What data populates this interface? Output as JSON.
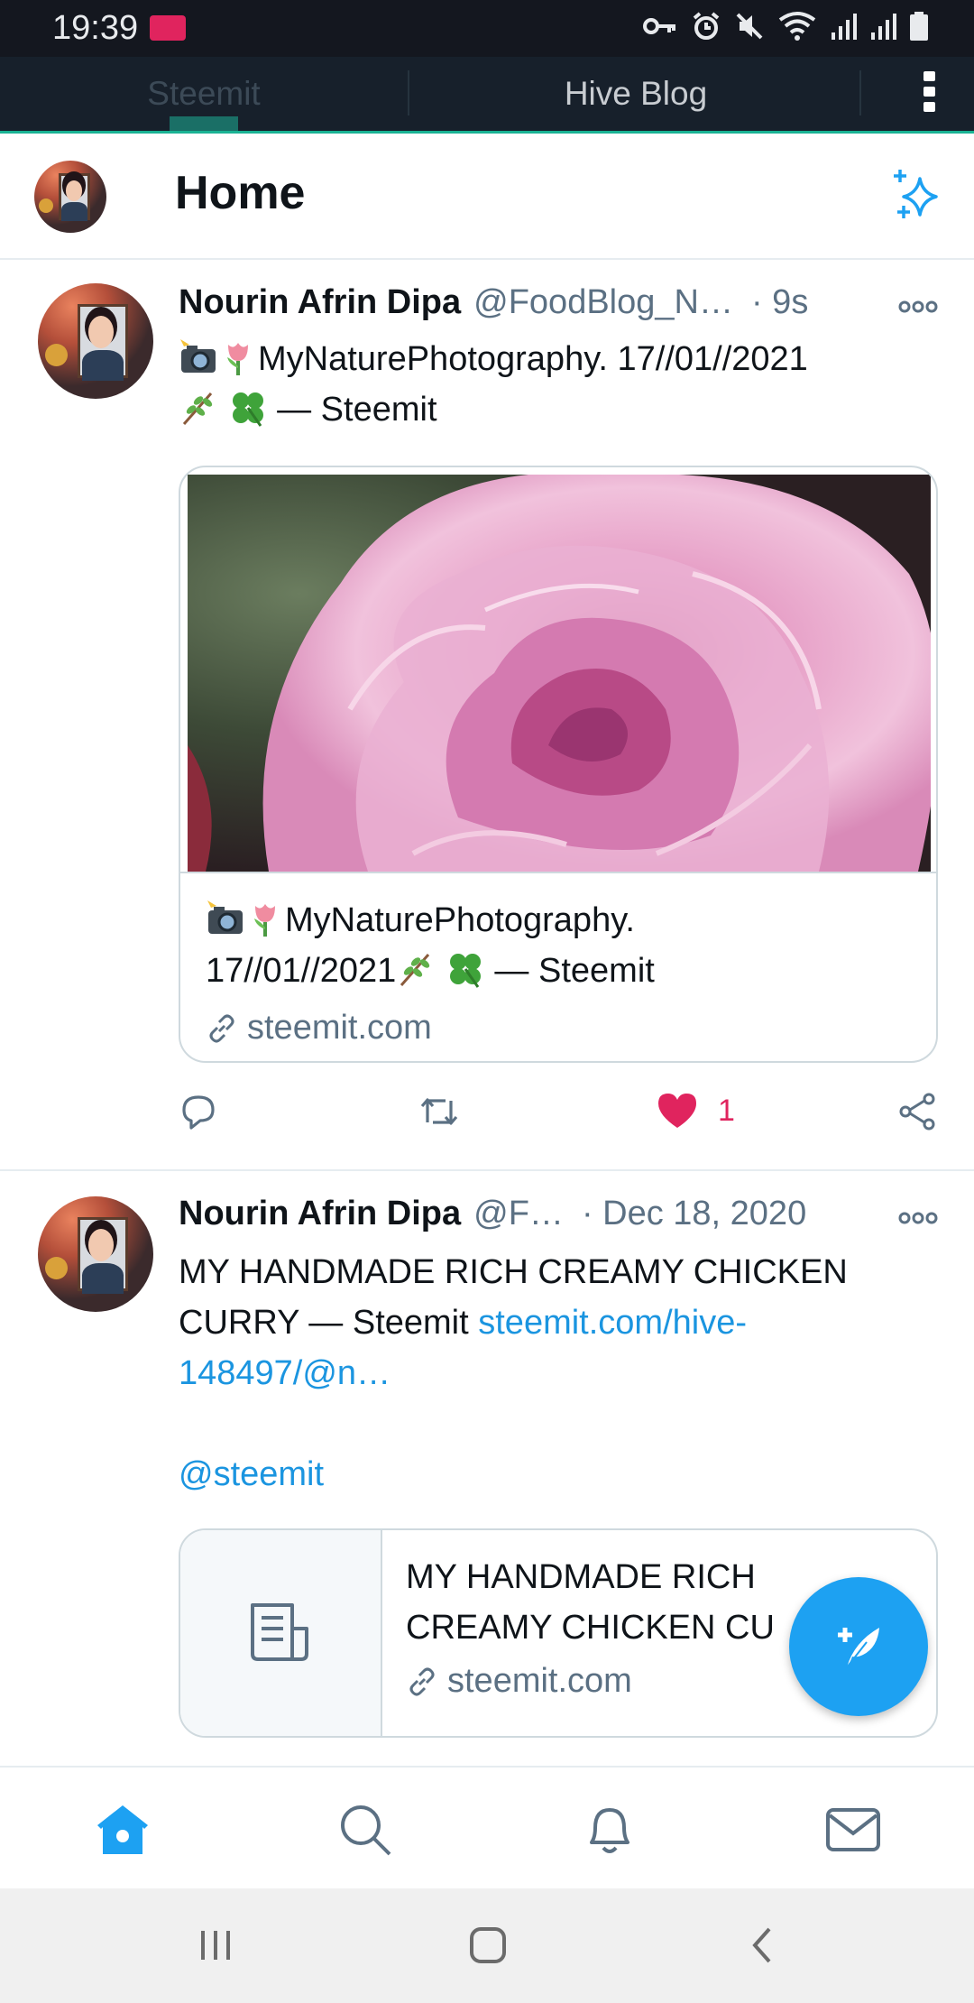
{
  "status_bar": {
    "time": "19:39",
    "icons": [
      "app-notification-icon",
      "key-icon",
      "alarm-icon",
      "mute-icon",
      "wifi-icon",
      "signal-icon",
      "signal-icon",
      "battery-icon"
    ]
  },
  "tabs": [
    {
      "label": "Steemit",
      "selected": true
    },
    {
      "label": "Hive Blog",
      "selected": false
    }
  ],
  "header": {
    "title": "Home",
    "sparkle_icon": "sparkle-icon"
  },
  "tweets": [
    {
      "author": "Nourin Afrin Dipa",
      "handle": "@FoodBlog_N…",
      "time": "· 9s",
      "text": "MyNaturePhotography. 17//01//2021",
      "text_suffix": " — Steemit",
      "card": {
        "title_a": "MyNaturePhotography.",
        "title_b": "17//01//2021",
        "title_suffix": " — Steemit",
        "domain": "steemit.com"
      },
      "actions": {
        "like_count": "1"
      }
    },
    {
      "author": "Nourin Afrin Dipa",
      "handle": "@F…",
      "time": "· Dec 18, 2020",
      "text": "MY HANDMADE RICH CREAMY CHICKEN CURRY — Steemit ",
      "link": "steemit.com/hive-148497/@n…",
      "mention": "@steemit",
      "card": {
        "title": "MY HANDMADE RICH CREAMY CHICKEN CU",
        "domain": "steemit.com"
      }
    }
  ],
  "colors": {
    "accent": "#1da1f2",
    "like": "#e0245e",
    "status_bar": "#14171f",
    "tab_bar": "#17202b",
    "tab_indicator": "#1ab394"
  }
}
